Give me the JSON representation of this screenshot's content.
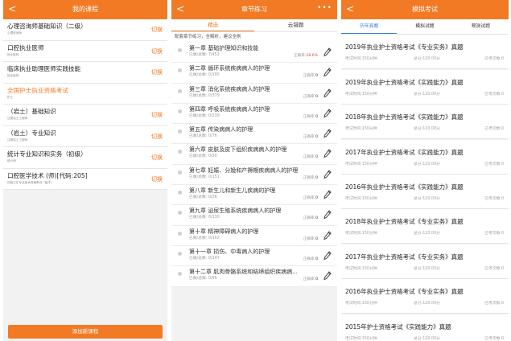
{
  "panel1": {
    "title": "我的课程",
    "back": "<",
    "courses": [
      {
        "name": "心理咨询师基础知识（二级）",
        "sub": "心理咨询师",
        "action": "切换"
      },
      {
        "name": "口腔执业医师",
        "sub": "执业医师",
        "action": "切换"
      },
      {
        "name": "临床执业助理医师实践技能",
        "sub": "执业医师",
        "action": "切换"
      },
      {
        "name": "全国护士执业资格考试",
        "sub": "护士",
        "action": ""
      },
      {
        "name": "（岩土）基础知识",
        "sub": "注册岩土工程师",
        "action": "切换"
      },
      {
        "name": "（岩土）专业知识",
        "sub": "注册岩土工程师",
        "action": "切换"
      },
      {
        "name": "统计专业知识和实务（初级）",
        "sub": "统计师",
        "action": "切换"
      },
      {
        "name": "口腔医学技术 (师)[代码:205]",
        "sub": "初级卫生专业技术资格考试（医疗）",
        "action": "切换"
      }
    ],
    "add_button": "添加新课程"
  },
  "panel2": {
    "title": "章节练习",
    "back": "<",
    "more": "•••",
    "tabs": [
      "精选",
      "云错题"
    ],
    "hint": "配套章节练习，全解析，建议全刷",
    "done_prefix": "已做/总数: ",
    "rate_prefix": "正确率:",
    "chapters": [
      {
        "title": "第一章 基础护理知识和技能",
        "progress": "7/452",
        "rate": "28.6%"
      },
      {
        "title": "第二章 循环系统疾病病人的护理",
        "progress": "0/195",
        "rate": "0"
      },
      {
        "title": "第三章 消化系统疾病病人的护理",
        "progress": "0/379",
        "rate": "0"
      },
      {
        "title": "第四章 呼吸系统疾病病人的护理",
        "progress": "0/239",
        "rate": "0"
      },
      {
        "title": "第五章 传染病病人的护理",
        "progress": "0/76",
        "rate": "0"
      },
      {
        "title": "第六章 皮肤及皮下组织疾病病人的护理",
        "progress": "0/30",
        "rate": "0"
      },
      {
        "title": "第七章 妊娠、分娩和产褥期疾病病人的护理",
        "progress": "0/151",
        "rate": "0"
      },
      {
        "title": "第八章 新生儿和新生儿疾病的护理",
        "progress": "0/26",
        "rate": "0"
      },
      {
        "title": "第九章 泌尿生殖系统疾病病人的护理",
        "progress": "0/130",
        "rate": "0"
      },
      {
        "title": "第十章 精神障碍病人的护理",
        "progress": "0/102",
        "rate": "0"
      },
      {
        "title": "第十一章 损伤、中毒病人的护理",
        "progress": "0/147",
        "rate": "0"
      },
      {
        "title": "第十二章 肌肉骨骼系统和结缔组织疾病病...",
        "progress": "0/66",
        "rate": "0"
      }
    ]
  },
  "panel3": {
    "title": "模拟考试",
    "back": "<",
    "tabs": [
      "历年真题",
      "模拟试题",
      "预测试题"
    ],
    "exams": [
      {
        "title": "2019年执业护士资格考试《专业实务》真题"
      },
      {
        "title": "2019年执业护士资格考试《实践能力》真题"
      },
      {
        "title": "2018年执业护士资格考试《实践能力》真题"
      },
      {
        "title": "2017年执业护士资格考试《实践能力》真题"
      },
      {
        "title": "2016年执业护士资格考试《实践能力》真题"
      },
      {
        "title": "2018年执业护士资格考试《专业实务》真题"
      },
      {
        "title": "2017年执业护士资格考试《专业实务》真题"
      },
      {
        "title": "2016年执业护士资格考试《专业实务》真题"
      },
      {
        "title": "2015年护士资格考试《实践能力》真题"
      }
    ],
    "meta": {
      "time": "考试时间:150分钟",
      "score": "总分:120.00分",
      "count": "已考次数:0"
    }
  },
  "colors": {
    "accent": "#f27a24",
    "blue": "#2f7fe0",
    "red": "#e23d3d"
  },
  "icons": {
    "edit": "pencil-icon",
    "back": "back-arrow-icon",
    "more": "more-icon"
  }
}
